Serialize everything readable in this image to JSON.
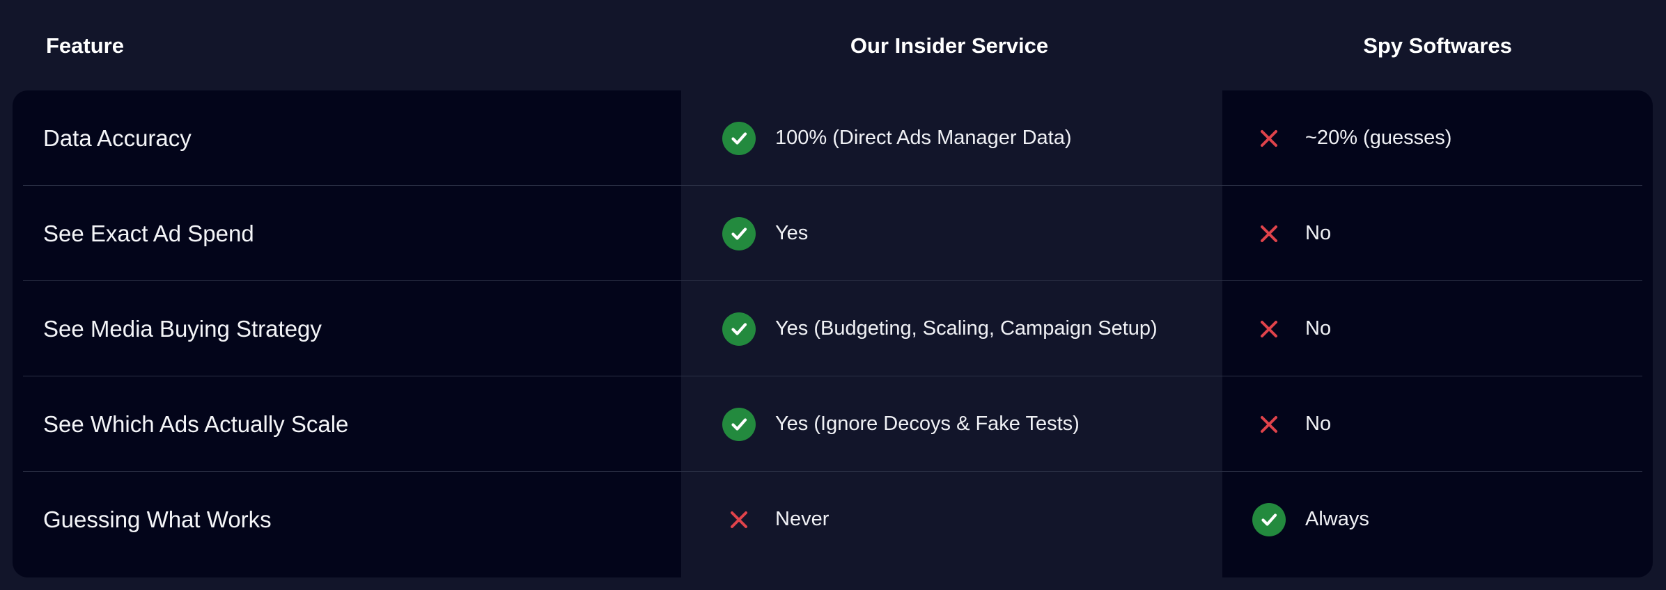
{
  "colors": {
    "check_bg": "#238a3e",
    "cross": "#e0434b",
    "background": "#12152a",
    "panel_dark": "#03051a"
  },
  "headers": {
    "feature": "Feature",
    "insider": "Our Insider Service",
    "spy": "Spy Softwares"
  },
  "rows": [
    {
      "feature": "Data Accuracy",
      "insider": {
        "icon": "check-icon",
        "text": "100% (Direct Ads Manager Data)"
      },
      "spy": {
        "icon": "cross-icon",
        "text": "~20% (guesses)"
      }
    },
    {
      "feature": "See Exact Ad Spend",
      "insider": {
        "icon": "check-icon",
        "text": "Yes"
      },
      "spy": {
        "icon": "cross-icon",
        "text": "No"
      }
    },
    {
      "feature": "See Media Buying Strategy",
      "insider": {
        "icon": "check-icon",
        "text": "Yes (Budgeting, Scaling, Campaign Setup)"
      },
      "spy": {
        "icon": "cross-icon",
        "text": "No"
      }
    },
    {
      "feature": "See Which Ads Actually Scale",
      "insider": {
        "icon": "check-icon",
        "text": "Yes (Ignore Decoys & Fake Tests)"
      },
      "spy": {
        "icon": "cross-icon",
        "text": "No"
      }
    },
    {
      "feature": "Guessing What Works",
      "insider": {
        "icon": "cross-icon",
        "text": "Never"
      },
      "spy": {
        "icon": "check-icon",
        "text": "Always"
      }
    }
  ]
}
